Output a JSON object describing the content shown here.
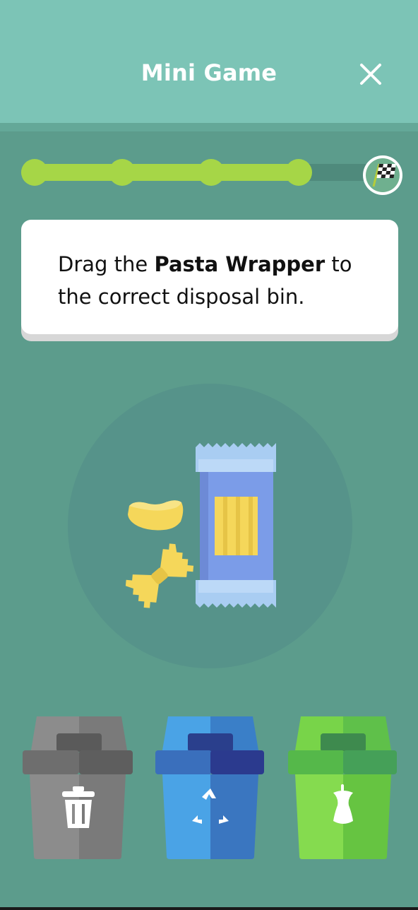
{
  "header": {
    "title": "Mini Game",
    "close_icon": "close-icon"
  },
  "progress": {
    "completed_steps": 4,
    "fill_fraction": 0.82,
    "end_icon": "checkered-flag-icon"
  },
  "instruction": {
    "prefix": "Drag the ",
    "item_name": "Pasta Wrapper",
    "suffix": " to the correct disposal bin."
  },
  "item": {
    "name": "Pasta Wrapper",
    "icon": "pasta-wrapper-icon"
  },
  "bins": [
    {
      "type": "trash",
      "icon": "trash-can-icon",
      "color": "#8c8c8c"
    },
    {
      "type": "recycle",
      "icon": "recycle-icon",
      "color": "#4aa3e6"
    },
    {
      "type": "compost",
      "icon": "apple-core-icon",
      "color": "#78d449"
    }
  ],
  "colors": {
    "background": "#5c9c8c",
    "header": "#7cc4b6",
    "progress_fill": "#a6d647",
    "progress_track": "#4f8a7c",
    "card": "#ffffff"
  }
}
